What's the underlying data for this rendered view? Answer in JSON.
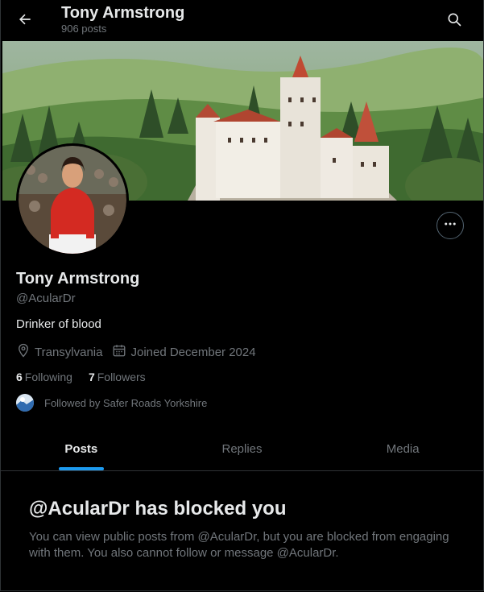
{
  "header": {
    "title": "Tony Armstrong",
    "post_count": "906 posts",
    "back_icon": "arrow-left-icon",
    "search_icon": "search-icon"
  },
  "profile": {
    "display_name": "Tony Armstrong",
    "handle": "@AcularDr",
    "bio": "Drinker of blood",
    "location": "Transylvania",
    "joined": "Joined December 2024",
    "following_count": "6",
    "following_label": "Following",
    "followers_count": "7",
    "followers_label": "Followers",
    "followed_by": "Followed by Safer Roads Yorkshire"
  },
  "tabs": [
    {
      "label": "Posts",
      "active": true
    },
    {
      "label": "Replies",
      "active": false
    },
    {
      "label": "Media",
      "active": false
    }
  ],
  "blocked": {
    "title": "@AcularDr has blocked you",
    "body": "You can view public posts from @AcularDr, but you are blocked from engaging with them. You also cannot follow or message @AcularDr."
  },
  "colors": {
    "background": "#000000",
    "text_primary": "#e7e9ea",
    "text_secondary": "#71767b",
    "accent": "#1d9bf0",
    "border": "#2f3336"
  }
}
